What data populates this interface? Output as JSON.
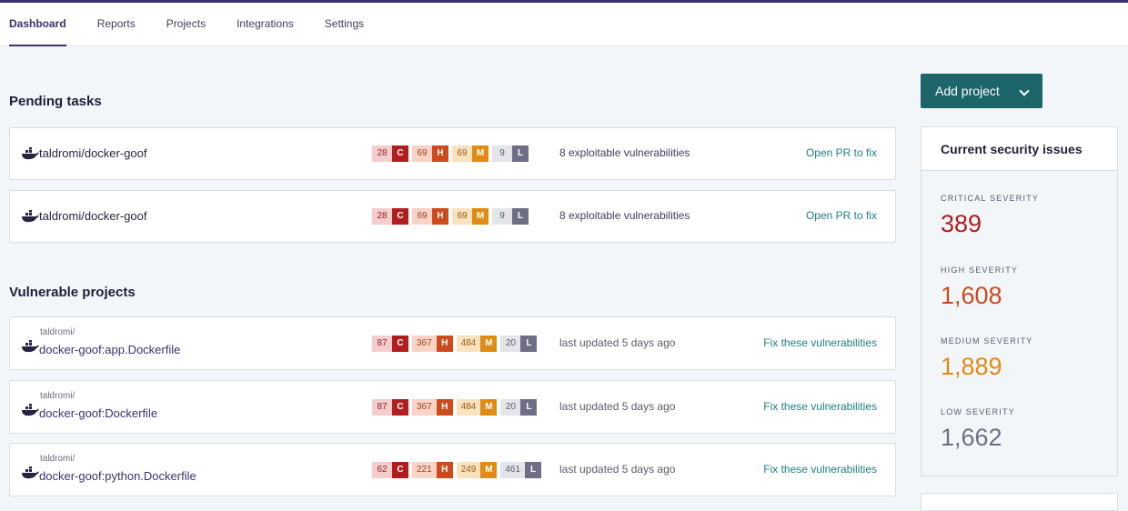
{
  "nav": {
    "tabs": [
      {
        "label": "Dashboard"
      },
      {
        "label": "Reports"
      },
      {
        "label": "Projects"
      },
      {
        "label": "Integrations"
      },
      {
        "label": "Settings"
      }
    ]
  },
  "pending": {
    "title": "Pending tasks",
    "rows": [
      {
        "name": "taldromi/docker-goof",
        "critical": "28",
        "high": "69",
        "medium": "69",
        "low": "9",
        "summary": "8 exploitable vulnerabilities",
        "action": "Open PR to fix"
      },
      {
        "name": "taldromi/docker-goof",
        "critical": "28",
        "high": "69",
        "medium": "69",
        "low": "9",
        "summary": "8 exploitable vulnerabilities",
        "action": "Open PR to fix"
      }
    ]
  },
  "vulnerable": {
    "title": "Vulnerable projects",
    "rows": [
      {
        "org": "taldromi/",
        "name": "docker-goof:app.Dockerfile",
        "critical": "87",
        "high": "367",
        "medium": "484",
        "low": "20",
        "updated": "last updated 5 days ago",
        "action": "Fix these vulnerabilities"
      },
      {
        "org": "taldromi/",
        "name": "docker-goof:Dockerfile",
        "critical": "87",
        "high": "367",
        "medium": "484",
        "low": "20",
        "updated": "last updated 5 days ago",
        "action": "Fix these vulnerabilities"
      },
      {
        "org": "taldromi/",
        "name": "docker-goof:python.Dockerfile",
        "critical": "62",
        "high": "221",
        "medium": "249",
        "low": "461",
        "updated": "last updated 5 days ago",
        "action": "Fix these vulnerabilities"
      }
    ]
  },
  "severity_letters": {
    "critical": "C",
    "high": "H",
    "medium": "M",
    "low": "L"
  },
  "add_project": {
    "label": "Add project"
  },
  "security": {
    "title": "Current security issues",
    "stats": [
      {
        "label": "CRITICAL SEVERITY",
        "value": "389",
        "color": "#b01e1e"
      },
      {
        "label": "HIGH SEVERITY",
        "value": "1,608",
        "color": "#ce4a1c"
      },
      {
        "label": "MEDIUM SEVERITY",
        "value": "1,889",
        "color": "#e08b12"
      },
      {
        "label": "LOW SEVERITY",
        "value": "1,662",
        "color": "#6f6e87"
      }
    ]
  },
  "colors": {
    "brand": "#3b3171",
    "action_teal": "#1e7f82",
    "button": "#1c6568"
  },
  "icons": {
    "project": "docker-whale-icon",
    "dropdown": "chevron-down-icon"
  }
}
